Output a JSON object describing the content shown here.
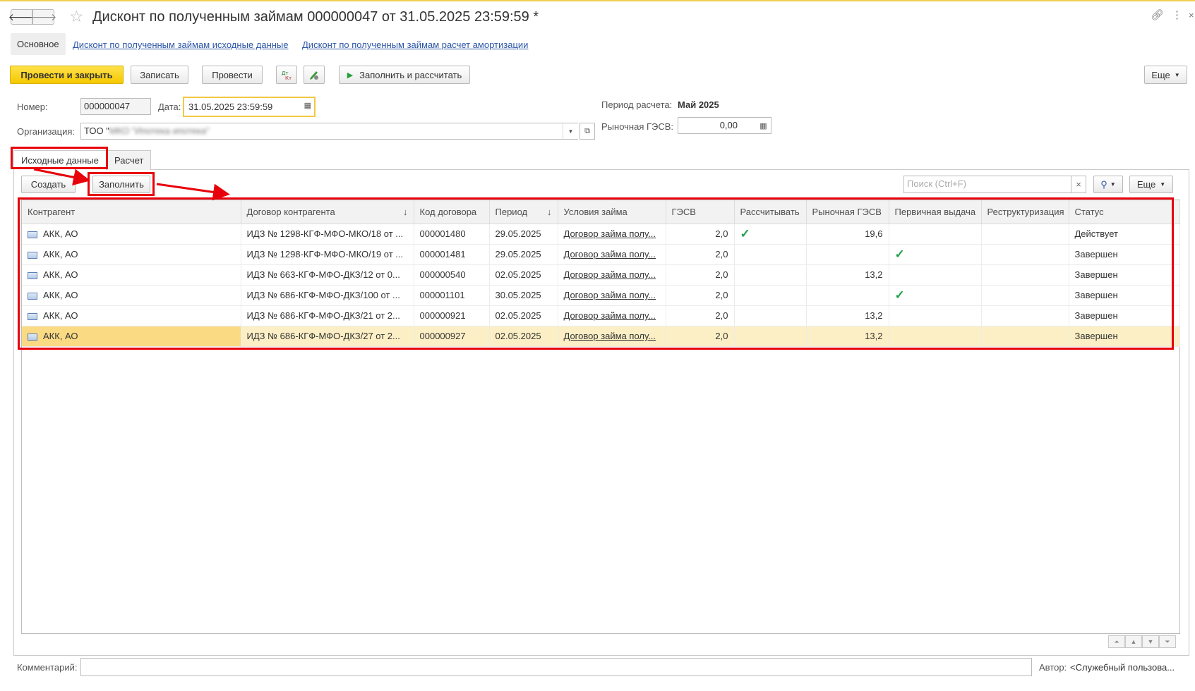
{
  "window": {
    "title": "Дисконт по полученным займам 000000047 от 31.05.2025 23:59:59 *",
    "back_glyph": "🡐",
    "forward_glyph": "🡒"
  },
  "top_tabs": {
    "main": "Основное",
    "link1": "Дисконт по полученным займам исходные данные",
    "link2": "Дисконт по полученным займам расчет амортизации"
  },
  "toolbar": {
    "post_close": "Провести и закрыть",
    "save": "Записать",
    "post": "Провести",
    "fill_calc": "Заполнить и рассчитать",
    "more": "Еще"
  },
  "form": {
    "number_label": "Номер:",
    "number_value": "000000047",
    "date_label": "Дата:",
    "date_value": "31.05.2025 23:59:59",
    "org_label": "Организация:",
    "org_value_prefix": "ТОО \"",
    "org_value_hidden": "МКО \"Ипотека ипотека\"",
    "period_label": "Период расчета:",
    "period_value": "Май 2025",
    "market_label": "Рыночная ГЭСВ:",
    "market_value": "0,00"
  },
  "tabs": {
    "source": "Исходные данные",
    "calc": "Расчет"
  },
  "table_toolbar": {
    "create": "Создать",
    "fill": "Заполнить",
    "search_placeholder": "Поиск (Ctrl+F)",
    "more": "Еще"
  },
  "table": {
    "columns": [
      "Контрагент",
      "Договор контрагента",
      "Код договора",
      "Период",
      "Условия займа",
      "ГЭСВ",
      "Рассчитывать",
      "Рыночная ГЭСВ",
      "Первичная выдача",
      "Реструктуризация",
      "Статус"
    ],
    "rows": [
      {
        "counterparty": "АКК, АО",
        "contract": "ИДЗ № 1298-КГФ-МФО-МКО/18 от ...",
        "code": "000001480",
        "period": "29.05.2025",
        "terms": "Договор займа полу...",
        "gesv": "2,0",
        "calculate": true,
        "market": "19,6",
        "primary": false,
        "restructuring": false,
        "status": "Действует"
      },
      {
        "counterparty": "АКК, АО",
        "contract": "ИДЗ № 1298-КГФ-МФО-МКО/19 от ...",
        "code": "000001481",
        "period": "29.05.2025",
        "terms": "Договор займа полу...",
        "gesv": "2,0",
        "calculate": false,
        "market": "",
        "primary": true,
        "restructuring": false,
        "status": "Завершен"
      },
      {
        "counterparty": "АКК, АО",
        "contract": "ИДЗ № 663-КГФ-МФО-ДКЗ/12 от 0...",
        "code": "000000540",
        "period": "02.05.2025",
        "terms": "Договор займа полу...",
        "gesv": "2,0",
        "calculate": false,
        "market": "13,2",
        "primary": false,
        "restructuring": false,
        "status": "Завершен"
      },
      {
        "counterparty": "АКК, АО",
        "contract": "ИДЗ № 686-КГФ-МФО-ДКЗ/100 от ...",
        "code": "000001101",
        "period": "30.05.2025",
        "terms": "Договор займа полу...",
        "gesv": "2,0",
        "calculate": false,
        "market": "",
        "primary": true,
        "restructuring": false,
        "status": "Завершен"
      },
      {
        "counterparty": "АКК, АО",
        "contract": "ИДЗ № 686-КГФ-МФО-ДКЗ/21 от 2...",
        "code": "000000921",
        "period": "02.05.2025",
        "terms": "Договор займа полу...",
        "gesv": "2,0",
        "calculate": false,
        "market": "13,2",
        "primary": false,
        "restructuring": false,
        "status": "Завершен"
      },
      {
        "counterparty": "АКК, АО",
        "contract": "ИДЗ № 686-КГФ-МФО-ДКЗ/27 от 2...",
        "code": "000000927",
        "period": "02.05.2025",
        "terms": "Договор займа полу...",
        "gesv": "2,0",
        "calculate": false,
        "market": "13,2",
        "primary": false,
        "restructuring": false,
        "status": "Завершен",
        "selected": true
      }
    ]
  },
  "footer": {
    "comment_label": "Комментарий:",
    "comment_value": "",
    "author_label": "Автор:",
    "author_value": "<Служебный пользова..."
  },
  "colors": {
    "primary_button": "#f5c800",
    "link": "#2d56a6",
    "annotation": "#e8000a",
    "check": "#22a04a",
    "selected_row": "#fcefc5"
  }
}
